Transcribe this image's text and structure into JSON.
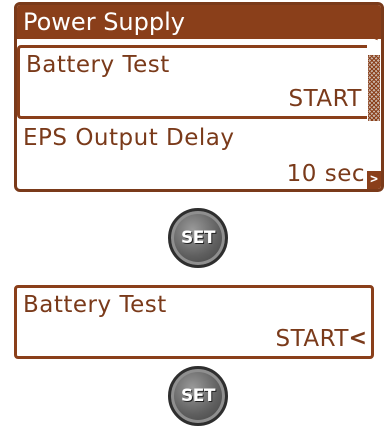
{
  "screen": {
    "title": "Power Supply",
    "items": [
      {
        "label": "Battery Test",
        "value": "START",
        "selected": true
      },
      {
        "label": "EPS Output Delay",
        "value": "10 sec",
        "selected": false
      }
    ],
    "scroll_up_glyph": "<",
    "scroll_down_glyph": ">"
  },
  "buttons": {
    "set_label": "SET"
  },
  "edit": {
    "label": "Battery Test",
    "value": "START",
    "cursor_glyph": "<"
  },
  "colors": {
    "lcd_accent": "#8a3f1a",
    "lcd_text": "#7a3a1a",
    "button_fill": "#5f5f5f"
  }
}
